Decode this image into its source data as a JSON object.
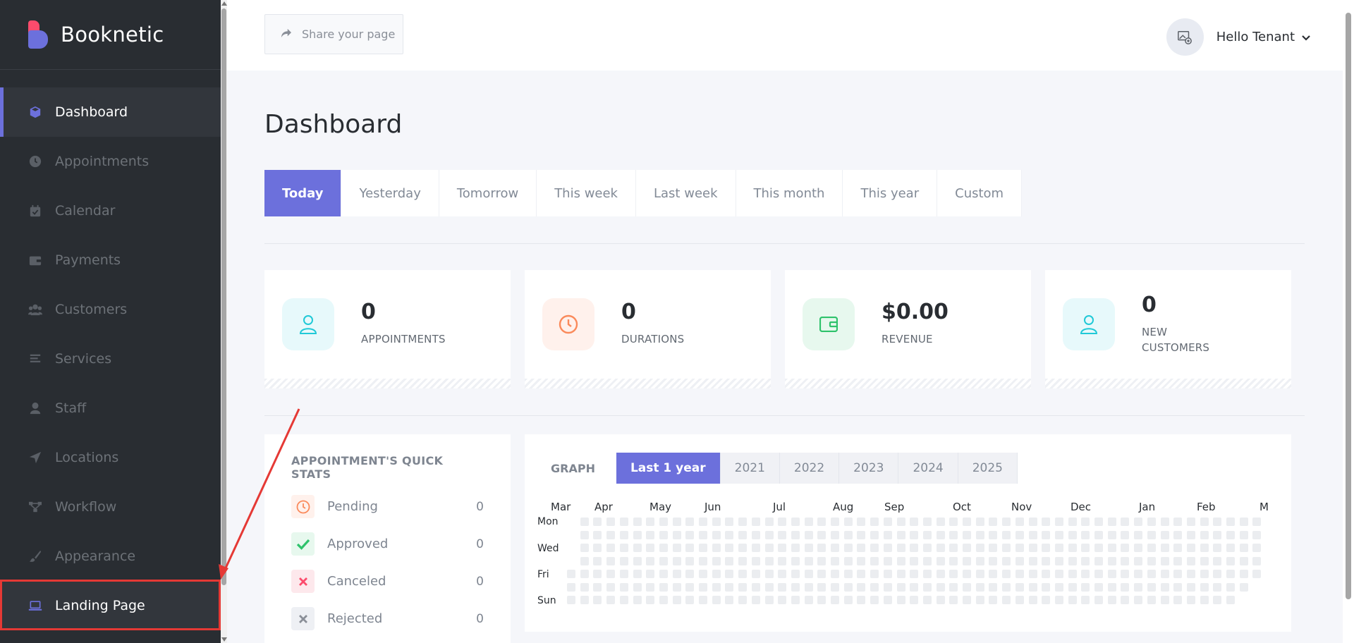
{
  "app": {
    "brand": "Booknetic"
  },
  "sidebar": {
    "items": [
      {
        "label": "Dashboard",
        "icon": "cube-icon"
      },
      {
        "label": "Appointments",
        "icon": "clock-icon"
      },
      {
        "label": "Calendar",
        "icon": "calendar-icon"
      },
      {
        "label": "Payments",
        "icon": "wallet-icon"
      },
      {
        "label": "Customers",
        "icon": "users-icon"
      },
      {
        "label": "Services",
        "icon": "list-icon"
      },
      {
        "label": "Staff",
        "icon": "user-icon"
      },
      {
        "label": "Locations",
        "icon": "location-arrow-icon"
      },
      {
        "label": "Workflow",
        "icon": "workflow-icon"
      },
      {
        "label": "Appearance",
        "icon": "brush-icon"
      },
      {
        "label": "Landing Page",
        "icon": "laptop-icon"
      }
    ]
  },
  "header": {
    "share_label": "Share your page",
    "user_name": "Hello Tenant"
  },
  "main": {
    "title": "Dashboard",
    "tabs": [
      "Today",
      "Yesterday",
      "Tomorrow",
      "This week",
      "Last week",
      "This month",
      "This year",
      "Custom"
    ],
    "cards": [
      {
        "value": "0",
        "label": "APPOINTMENTS",
        "icon": "user-icon",
        "color": "#20c9d7",
        "bg": "#e7f9fb"
      },
      {
        "value": "0",
        "label": "DURATIONS",
        "icon": "clock-icon",
        "color": "#fa8a5b",
        "bg": "#fff1ec"
      },
      {
        "value": "$0.00",
        "label": "REVENUE",
        "icon": "wallet-icon",
        "color": "#2ec26b",
        "bg": "#e7f8ee"
      },
      {
        "value": "0",
        "label": "NEW CUSTOMERS",
        "icon": "user-icon",
        "color": "#20c9d7",
        "bg": "#e7f9fb"
      }
    ],
    "quick_stats": {
      "title": "APPOINTMENT'S QUICK STATS",
      "rows": [
        {
          "label": "Pending",
          "value": "0",
          "icon": "clock-icon",
          "color": "#fa8a5b",
          "bg": "#fff1ec"
        },
        {
          "label": "Approved",
          "value": "0",
          "icon": "check-icon",
          "color": "#2ec26b",
          "bg": "#e7f8ee"
        },
        {
          "label": "Canceled",
          "value": "0",
          "icon": "x-icon",
          "color": "#fc4b6c",
          "bg": "#fde8ec"
        },
        {
          "label": "Rejected",
          "value": "0",
          "icon": "x-icon",
          "color": "#8a8f98",
          "bg": "#eef0f4"
        }
      ]
    },
    "graph": {
      "label": "GRAPH",
      "tabs": [
        "Last 1 year",
        "2021",
        "2022",
        "2023",
        "2024",
        "2025"
      ],
      "months": [
        "Mar",
        "Apr",
        "May",
        "Jun",
        "Jul",
        "Aug",
        "Sep",
        "Oct",
        "Nov",
        "Dec",
        "Jan",
        "Feb",
        "M"
      ],
      "days": [
        "Mon",
        "Wed",
        "Fri",
        "Sun"
      ]
    }
  }
}
